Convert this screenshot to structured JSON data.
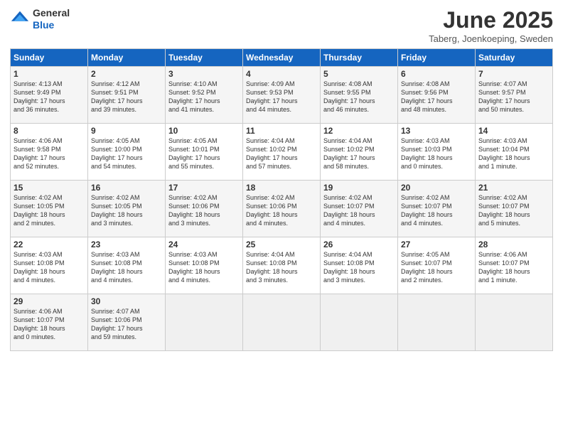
{
  "logo": {
    "line1": "General",
    "line2": "Blue"
  },
  "title": "June 2025",
  "subtitle": "Taberg, Joenkoeping, Sweden",
  "weekdays": [
    "Sunday",
    "Monday",
    "Tuesday",
    "Wednesday",
    "Thursday",
    "Friday",
    "Saturday"
  ],
  "weeks": [
    [
      {
        "day": "1",
        "info": "Sunrise: 4:13 AM\nSunset: 9:49 PM\nDaylight: 17 hours\nand 36 minutes."
      },
      {
        "day": "2",
        "info": "Sunrise: 4:12 AM\nSunset: 9:51 PM\nDaylight: 17 hours\nand 39 minutes."
      },
      {
        "day": "3",
        "info": "Sunrise: 4:10 AM\nSunset: 9:52 PM\nDaylight: 17 hours\nand 41 minutes."
      },
      {
        "day": "4",
        "info": "Sunrise: 4:09 AM\nSunset: 9:53 PM\nDaylight: 17 hours\nand 44 minutes."
      },
      {
        "day": "5",
        "info": "Sunrise: 4:08 AM\nSunset: 9:55 PM\nDaylight: 17 hours\nand 46 minutes."
      },
      {
        "day": "6",
        "info": "Sunrise: 4:08 AM\nSunset: 9:56 PM\nDaylight: 17 hours\nand 48 minutes."
      },
      {
        "day": "7",
        "info": "Sunrise: 4:07 AM\nSunset: 9:57 PM\nDaylight: 17 hours\nand 50 minutes."
      }
    ],
    [
      {
        "day": "8",
        "info": "Sunrise: 4:06 AM\nSunset: 9:58 PM\nDaylight: 17 hours\nand 52 minutes."
      },
      {
        "day": "9",
        "info": "Sunrise: 4:05 AM\nSunset: 10:00 PM\nDaylight: 17 hours\nand 54 minutes."
      },
      {
        "day": "10",
        "info": "Sunrise: 4:05 AM\nSunset: 10:01 PM\nDaylight: 17 hours\nand 55 minutes."
      },
      {
        "day": "11",
        "info": "Sunrise: 4:04 AM\nSunset: 10:02 PM\nDaylight: 17 hours\nand 57 minutes."
      },
      {
        "day": "12",
        "info": "Sunrise: 4:04 AM\nSunset: 10:02 PM\nDaylight: 17 hours\nand 58 minutes."
      },
      {
        "day": "13",
        "info": "Sunrise: 4:03 AM\nSunset: 10:03 PM\nDaylight: 18 hours\nand 0 minutes."
      },
      {
        "day": "14",
        "info": "Sunrise: 4:03 AM\nSunset: 10:04 PM\nDaylight: 18 hours\nand 1 minute."
      }
    ],
    [
      {
        "day": "15",
        "info": "Sunrise: 4:02 AM\nSunset: 10:05 PM\nDaylight: 18 hours\nand 2 minutes."
      },
      {
        "day": "16",
        "info": "Sunrise: 4:02 AM\nSunset: 10:05 PM\nDaylight: 18 hours\nand 3 minutes."
      },
      {
        "day": "17",
        "info": "Sunrise: 4:02 AM\nSunset: 10:06 PM\nDaylight: 18 hours\nand 3 minutes."
      },
      {
        "day": "18",
        "info": "Sunrise: 4:02 AM\nSunset: 10:06 PM\nDaylight: 18 hours\nand 4 minutes."
      },
      {
        "day": "19",
        "info": "Sunrise: 4:02 AM\nSunset: 10:07 PM\nDaylight: 18 hours\nand 4 minutes."
      },
      {
        "day": "20",
        "info": "Sunrise: 4:02 AM\nSunset: 10:07 PM\nDaylight: 18 hours\nand 4 minutes."
      },
      {
        "day": "21",
        "info": "Sunrise: 4:02 AM\nSunset: 10:07 PM\nDaylight: 18 hours\nand 5 minutes."
      }
    ],
    [
      {
        "day": "22",
        "info": "Sunrise: 4:03 AM\nSunset: 10:08 PM\nDaylight: 18 hours\nand 4 minutes."
      },
      {
        "day": "23",
        "info": "Sunrise: 4:03 AM\nSunset: 10:08 PM\nDaylight: 18 hours\nand 4 minutes."
      },
      {
        "day": "24",
        "info": "Sunrise: 4:03 AM\nSunset: 10:08 PM\nDaylight: 18 hours\nand 4 minutes."
      },
      {
        "day": "25",
        "info": "Sunrise: 4:04 AM\nSunset: 10:08 PM\nDaylight: 18 hours\nand 3 minutes."
      },
      {
        "day": "26",
        "info": "Sunrise: 4:04 AM\nSunset: 10:08 PM\nDaylight: 18 hours\nand 3 minutes."
      },
      {
        "day": "27",
        "info": "Sunrise: 4:05 AM\nSunset: 10:07 PM\nDaylight: 18 hours\nand 2 minutes."
      },
      {
        "day": "28",
        "info": "Sunrise: 4:06 AM\nSunset: 10:07 PM\nDaylight: 18 hours\nand 1 minute."
      }
    ],
    [
      {
        "day": "29",
        "info": "Sunrise: 4:06 AM\nSunset: 10:07 PM\nDaylight: 18 hours\nand 0 minutes."
      },
      {
        "day": "30",
        "info": "Sunrise: 4:07 AM\nSunset: 10:06 PM\nDaylight: 17 hours\nand 59 minutes."
      },
      {
        "day": "",
        "info": ""
      },
      {
        "day": "",
        "info": ""
      },
      {
        "day": "",
        "info": ""
      },
      {
        "day": "",
        "info": ""
      },
      {
        "day": "",
        "info": ""
      }
    ]
  ]
}
